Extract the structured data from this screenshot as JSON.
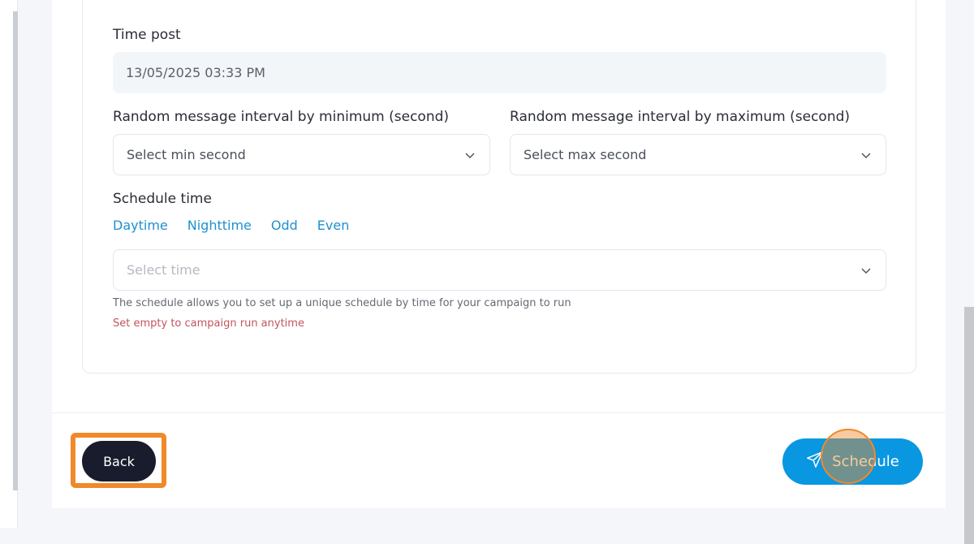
{
  "form": {
    "time_post_label": "Time post",
    "time_post_value": "13/05/2025 03:33 PM",
    "min_interval_label": "Random message interval by minimum (second)",
    "min_interval_placeholder": "Select min second",
    "max_interval_label": "Random message interval by maximum (second)",
    "max_interval_placeholder": "Select max second",
    "schedule_time_label": "Schedule time",
    "quick_options": [
      "Daytime",
      "Nighttime",
      "Odd",
      "Even"
    ],
    "select_time_placeholder": "Select time",
    "schedule_hint": "The schedule allows you to set up a unique schedule by time for your campaign to run",
    "empty_hint": "Set empty to campaign run anytime"
  },
  "footer": {
    "back_label": "Back",
    "schedule_label": "Schedule"
  },
  "colors": {
    "accent": "#0a97e1",
    "link": "#1e90d0",
    "dark_button": "#191c2d",
    "warning_text": "#c2545d",
    "highlight": "#f0892a"
  },
  "icons": {
    "dropdown": "chevron-down-icon",
    "schedule": "paper-plane-icon"
  }
}
